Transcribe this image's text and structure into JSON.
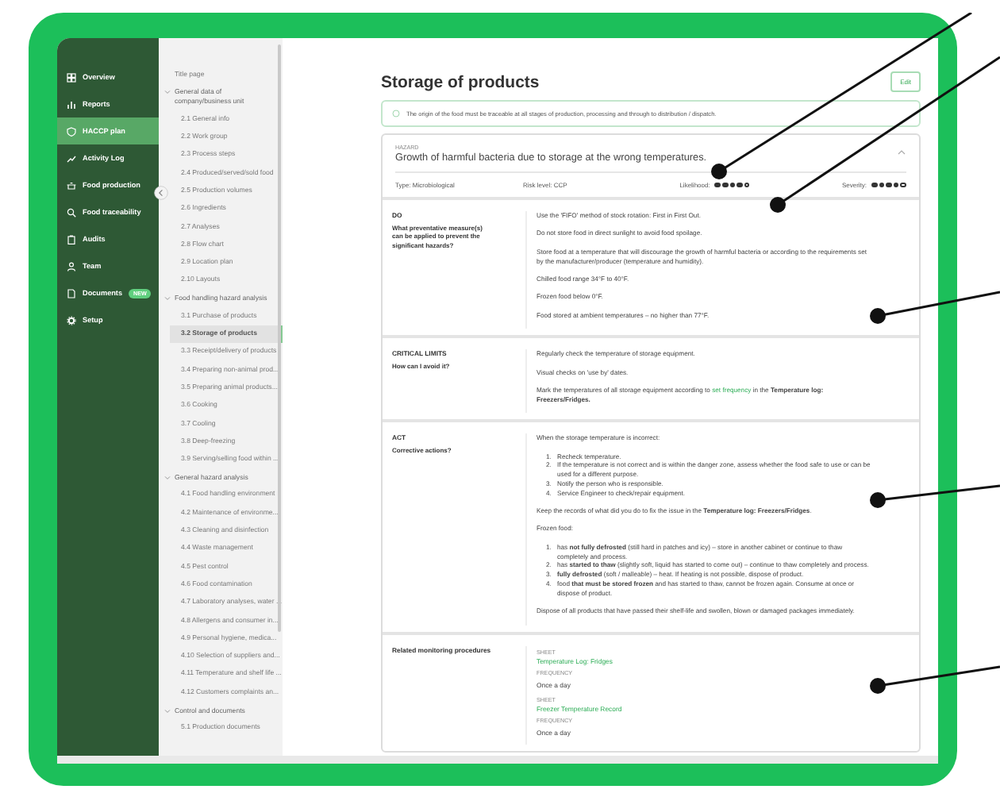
{
  "sidebar": {
    "items": [
      {
        "label": "Overview",
        "selected": false
      },
      {
        "label": "Reports",
        "selected": false
      },
      {
        "label": "HACCP plan",
        "selected": true
      },
      {
        "label": "Activity Log",
        "selected": false
      },
      {
        "label": "Food production",
        "selected": false
      },
      {
        "label": "Food traceability",
        "selected": false
      },
      {
        "label": "Audits",
        "selected": false
      },
      {
        "label": "Team",
        "selected": false
      },
      {
        "label": "Documents",
        "selected": false,
        "badge": "NEW"
      },
      {
        "label": "Setup",
        "selected": false
      }
    ]
  },
  "subnav": {
    "items": [
      {
        "label": "Title page",
        "selected": false
      },
      {
        "label": "General data of company/business unit",
        "expanded": true,
        "children": [
          {
            "label": "2.1 General info",
            "selected": false
          },
          {
            "label": "2.2 Work group",
            "selected": false
          },
          {
            "label": "2.3 Process steps",
            "selected": false
          },
          {
            "label": "2.4 Produced/served/sold food",
            "selected": false
          },
          {
            "label": "2.5 Production volumes",
            "selected": false
          },
          {
            "label": "2.6 Ingredients",
            "selected": false
          },
          {
            "label": "2.7 Analyses",
            "selected": false
          },
          {
            "label": "2.8 Flow chart",
            "selected": false
          },
          {
            "label": "2.9 Location plan",
            "selected": false
          },
          {
            "label": "2.10 Layouts",
            "selected": false
          }
        ]
      },
      {
        "label": "Food handling hazard analysis",
        "expanded": true,
        "children": [
          {
            "label": "3.1 Purchase of products",
            "selected": false
          },
          {
            "label": "3.2 Storage of products",
            "selected": true
          },
          {
            "label": "3.3 Receipt/delivery of products",
            "selected": false
          },
          {
            "label": "3.4 Preparing non-animal prod...",
            "selected": false
          },
          {
            "label": "3.5 Preparing animal products...",
            "selected": false
          },
          {
            "label": "3.6 Cooking",
            "selected": false
          },
          {
            "label": "3.7 Cooling",
            "selected": false
          },
          {
            "label": "3.8 Deep-freezing",
            "selected": false
          },
          {
            "label": "3.9 Serving/selling food within ...",
            "selected": false
          }
        ]
      },
      {
        "label": "General hazard analysis",
        "expanded": true,
        "children": [
          {
            "label": "4.1 Food handling environment",
            "selected": false
          },
          {
            "label": "4.2 Maintenance of environme...",
            "selected": false
          },
          {
            "label": "4.3 Cleaning and disinfection",
            "selected": false
          },
          {
            "label": "4.4 Waste management",
            "selected": false
          },
          {
            "label": "4.5 Pest control",
            "selected": false
          },
          {
            "label": "4.6 Food contamination",
            "selected": false
          },
          {
            "label": "4.7 Laboratory analyses, water ...",
            "selected": false
          },
          {
            "label": "4.8 Allergens and consumer in...",
            "selected": false
          },
          {
            "label": "4.9 Personal hygiene, medica...",
            "selected": false
          },
          {
            "label": "4.10 Selection of suppliers and...",
            "selected": false
          },
          {
            "label": "4.11 Temperature and shelf life ...",
            "selected": false
          },
          {
            "label": "4.12 Customers complaints an...",
            "selected": false
          }
        ]
      },
      {
        "label": "Control and documents",
        "expanded": true,
        "children": [
          {
            "label": "5.1 Production documents",
            "selected": false
          }
        ]
      }
    ]
  },
  "page": {
    "title": "Storage of products",
    "edit_button": "Edit"
  },
  "notice": "The origin of the food must be traceable at all stages of production, processing and through to distribution / dispatch.",
  "hazard": {
    "label": "HAZARD",
    "title": "Growth of harmful bacteria due to storage at the wrong temperatures.",
    "expanded": true,
    "type": "Type: Microbiological",
    "risk": "Risk level:  CCP",
    "ratings": [
      {
        "label": "Likelihood:",
        "stars": 4
      },
      {
        "label": "Severity:",
        "stars": 4
      }
    ]
  },
  "sections": [
    {
      "title": "DO",
      "question": "What preventative measure(s) can be applied to prevent the significant hazards?",
      "blocks": [
        {
          "kind": "para",
          "text": "Use the 'FIFO' method of stock rotation: First in First Out."
        },
        {
          "kind": "para",
          "text": "Do not store food in direct sunlight to avoid food spoilage."
        },
        {
          "kind": "para",
          "text": "Store food at a temperature that will discourage the growth of harmful bacteria or according to the requirements set by the manufacturer/producer (temperature and humidity)."
        },
        {
          "kind": "para",
          "text": "Chilled food range 34°F to 40°F."
        },
        {
          "kind": "para",
          "text": "Frozen food below 0°F."
        },
        {
          "kind": "para",
          "text": "Food stored at ambient temperatures – no higher than 77°F."
        }
      ]
    },
    {
      "title": "CRITICAL LIMITS",
      "question": "How can I avoid it?",
      "blocks": [
        {
          "kind": "para",
          "text": "Regularly check the temperature of storage equipment."
        },
        {
          "kind": "para",
          "text": "Visual checks on 'use by' dates."
        },
        {
          "kind": "linkpara",
          "before": "Mark the temperatures of all storage equipment according to",
          "link": "set frequency",
          "after": "in the **Temperature log: Freezers/Fridges.**"
        }
      ]
    },
    {
      "title": "ACT",
      "question": "Corrective actions?",
      "blocks": [
        {
          "kind": "para",
          "text": "When the storage temperature is incorrect:"
        },
        {
          "kind": "list",
          "items": [
            {
              "number": "1.",
              "text": "Recheck temperature."
            },
            {
              "number": "2.",
              "text": "If the temperature is not correct and is within the danger zone, assess whether the food safe to use or can be used for a different purpose."
            },
            {
              "number": "3.",
              "text": "Notify the person who is responsible."
            },
            {
              "number": "4.",
              "text": "Service Engineer to check/repair equipment."
            }
          ]
        },
        {
          "kind": "para",
          "text": "Keep the records of what did you do to fix the issue in the **Temperature log: Freezers/Fridges**."
        },
        {
          "kind": "para",
          "text": "Frozen food:"
        },
        {
          "kind": "list",
          "items": [
            {
              "number": "1.",
              "text": "has **not fully defrosted** (still hard in patches and icy) – store in another cabinet or continue to thaw completely and process."
            },
            {
              "number": "2.",
              "text": "has **started to thaw** (slightly soft, liquid has started to come out) – continue to thaw completely and process."
            },
            {
              "number": "3.",
              "text": "**fully defrosted** (soft / malleable) – heat. If heating is not possible, dispose of product."
            },
            {
              "number": "4.",
              "text": "food **that must be stored frozen** and has started to thaw, cannot be frozen again. Consume at once or dispose of product."
            }
          ]
        },
        {
          "kind": "para",
          "text": "Dispose of all products that have passed their shelf-life and swollen, blown or damaged packages immediately."
        }
      ]
    }
  ],
  "monitoring": {
    "title": "Related monitoring procedures",
    "procedures": [
      {
        "sheet_label": "SHEET",
        "sheet": "Temperature Log: Fridges",
        "frequency_label": "FREQUENCY",
        "frequency": "Once a day"
      },
      {
        "sheet_label": "SHEET",
        "sheet": "Freezer Temperature Record",
        "frequency_label": "FREQUENCY",
        "frequency": "Once a day"
      }
    ]
  }
}
